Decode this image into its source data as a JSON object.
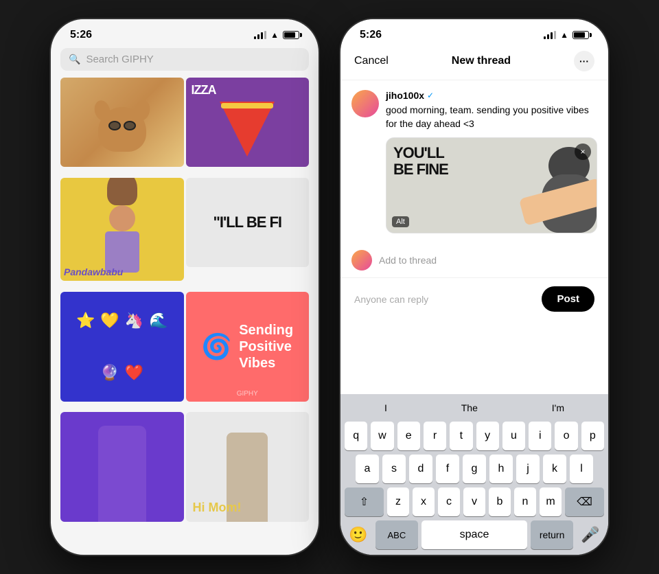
{
  "phone1": {
    "status_time": "5:26",
    "search_placeholder": "Search GIPHY",
    "gifs": [
      {
        "id": "dog",
        "label": "dog with sunglasses"
      },
      {
        "id": "pizza",
        "label": "pizza",
        "overlay": "IZZA"
      },
      {
        "id": "girl",
        "label": "girl",
        "caption": "Pandawbabu"
      },
      {
        "id": "youll-be-fine",
        "label": "you'll be fine text"
      },
      {
        "id": "emoji-magnets",
        "label": "emoji magnets"
      },
      {
        "id": "positive-vibes",
        "label": "Sending Positive Vibes",
        "text": "Sending\nPositive\nVibes"
      },
      {
        "id": "woman",
        "label": "woman clapping"
      },
      {
        "id": "hi-mom",
        "label": "Hi Mom guy",
        "caption": "Hi Mom!"
      }
    ]
  },
  "phone2": {
    "status_time": "5:26",
    "header": {
      "cancel_label": "Cancel",
      "title": "New thread",
      "more_label": "···"
    },
    "post": {
      "username": "jiho100x",
      "verified": true,
      "text": "good morning, team. sending you positive vibes for the day ahead <3",
      "gif_label": "YOU'LL BE FINE",
      "gif_alt": "Alt",
      "gif_close": "×"
    },
    "add_thread_label": "Add to thread",
    "footer": {
      "reply_label": "Anyone can reply",
      "post_button": "Post"
    },
    "keyboard": {
      "suggestions": [
        "I",
        "The",
        "I'm"
      ],
      "rows": [
        [
          "q",
          "w",
          "e",
          "r",
          "t",
          "y",
          "u",
          "i",
          "o",
          "p"
        ],
        [
          "a",
          "s",
          "d",
          "f",
          "g",
          "h",
          "j",
          "k",
          "l"
        ],
        [
          "z",
          "x",
          "c",
          "v",
          "b",
          "n",
          "m"
        ],
        [
          "ABC",
          "space",
          "return"
        ]
      ]
    }
  }
}
